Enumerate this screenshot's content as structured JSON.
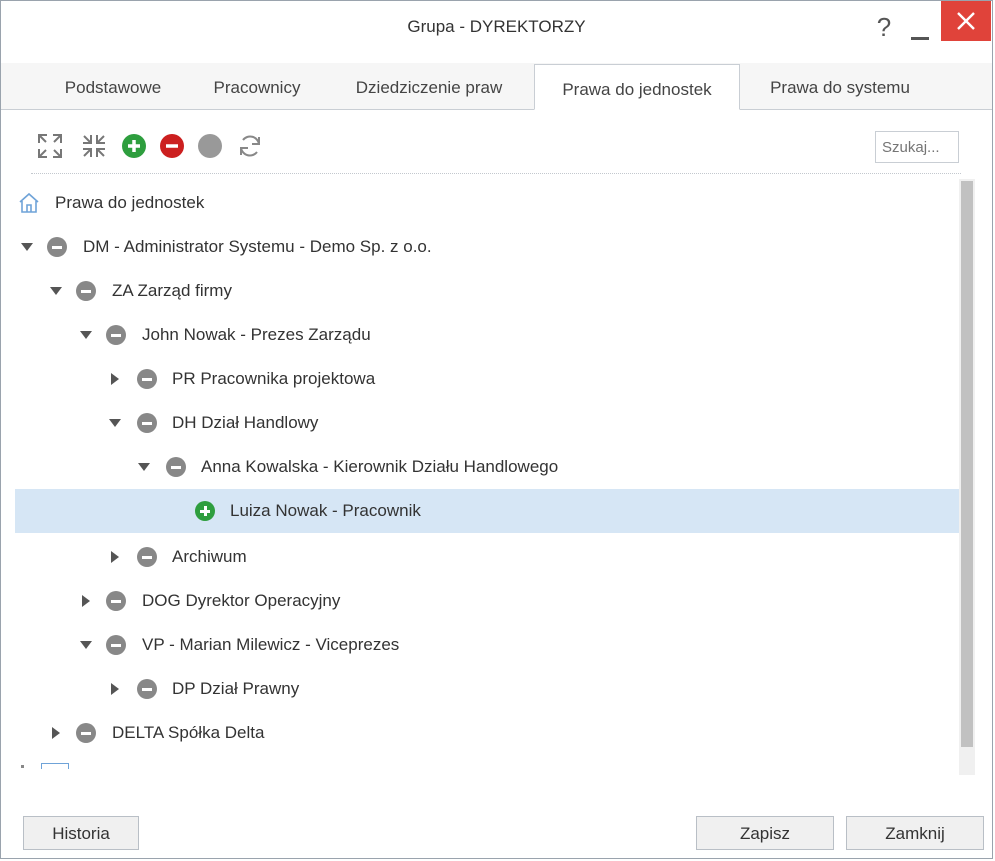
{
  "window": {
    "title": "Grupa - DYREKTORZY",
    "help_glyph": "?"
  },
  "tabs": [
    {
      "label": "Podstawowe"
    },
    {
      "label": "Pracownicy"
    },
    {
      "label": "Dziedziczenie praw"
    },
    {
      "label": "Prawa do jednostek",
      "active": true
    },
    {
      "label": "Prawa do systemu"
    }
  ],
  "toolbar": {
    "icons": [
      "expand-all-icon",
      "collapse-all-icon",
      "add-circle-icon",
      "remove-circle-icon",
      "neutral-circle-icon",
      "refresh-icon"
    ],
    "search_placeholder": "Szukaj..."
  },
  "tree": {
    "root_label": "Prawa do jednostek",
    "nodes": [
      {
        "label": "DM - Administrator Systemu - Demo Sp. z o.o.",
        "state": "minus",
        "expanded": true
      },
      {
        "label": "ZA Zarząd firmy",
        "state": "minus",
        "expanded": true
      },
      {
        "label": "John Nowak - Prezes Zarządu",
        "state": "minus",
        "expanded": true
      },
      {
        "label": "PR Pracownika projektowa",
        "state": "minus",
        "expanded": false
      },
      {
        "label": "DH Dział Handlowy",
        "state": "minus",
        "expanded": true
      },
      {
        "label": "Anna Kowalska - Kierownik Działu Handlowego",
        "state": "minus",
        "expanded": true
      },
      {
        "label": "Luiza Nowak - Pracownik",
        "state": "plus",
        "selected": true
      },
      {
        "label": "Archiwum",
        "state": "minus",
        "expanded": false
      },
      {
        "label": "DOG Dyrektor Operacyjny",
        "state": "minus",
        "expanded": false
      },
      {
        "label": "VP - Marian Milewicz - Viceprezes",
        "state": "minus",
        "expanded": true
      },
      {
        "label": "DP Dział Prawny",
        "state": "minus",
        "expanded": false
      },
      {
        "label": "DELTA Spółka Delta",
        "state": "minus",
        "expanded": false
      }
    ]
  },
  "footer": {
    "history_label": "Historia",
    "save_label": "Zapisz",
    "close_label": "Zamknij"
  },
  "colors": {
    "accent_close": "#e0433a",
    "selected_row": "#d6e6f5",
    "plus_green": "#2e9e3e",
    "minus_red": "#cc1f1f",
    "neutral_gray": "#888888"
  }
}
